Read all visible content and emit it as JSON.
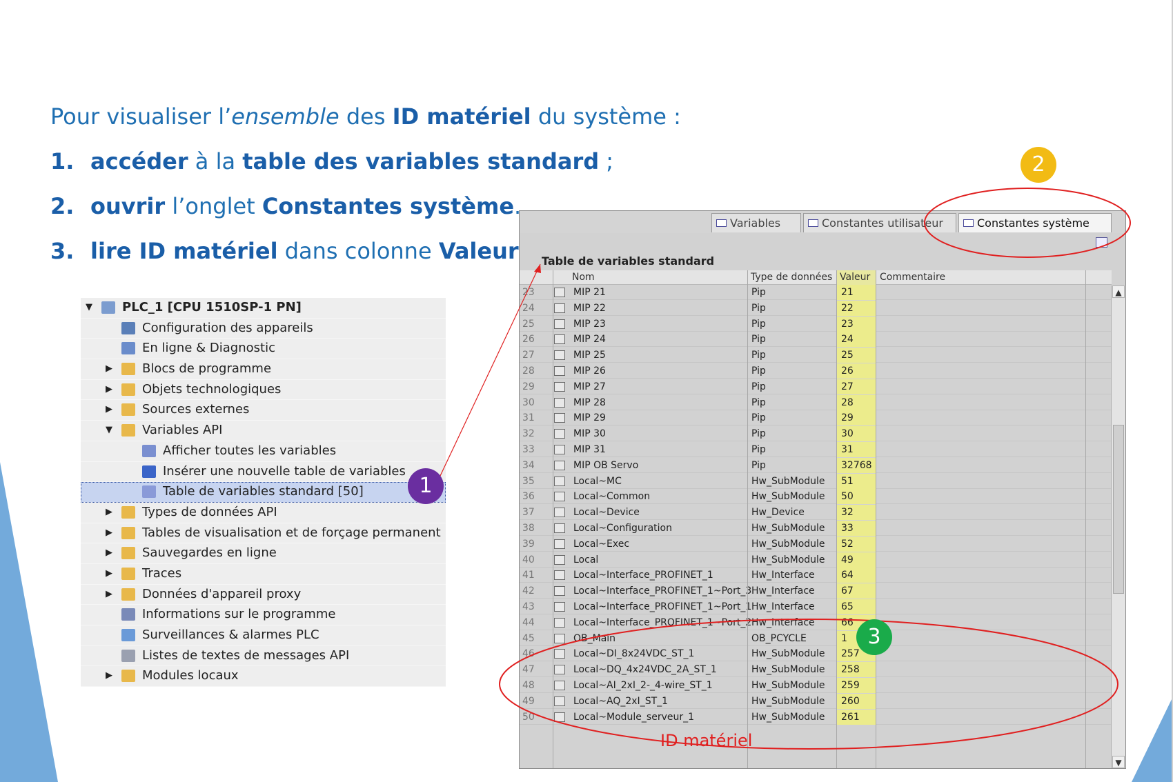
{
  "heading": {
    "prefix": "Pour visualiser l’",
    "italic": "ensemble",
    "mid": " des ",
    "bold": "ID matériel",
    "suffix": " du système :"
  },
  "steps": [
    {
      "num": "1.",
      "bold1": "accéder",
      "text1": " à la ",
      "bold2": "table des variables standard",
      "text2": " ;"
    },
    {
      "num": "2.",
      "bold1": "ouvrir",
      "text1": " l’onglet ",
      "bold2": "Constantes système",
      "text2": "."
    },
    {
      "num": "3.",
      "bold1": "lire ID matériel",
      "text1": " dans colonne ",
      "bold2": "Valeur",
      "text2": ""
    }
  ],
  "tree": {
    "root": "PLC_1 [CPU 1510SP-1 PN]",
    "items": [
      {
        "label": "Configuration des appareils",
        "level": 1,
        "arrow": "",
        "icon": "device-config-icon"
      },
      {
        "label": "En ligne & Diagnostic",
        "level": 1,
        "arrow": "",
        "icon": "diagnostic-icon"
      },
      {
        "label": "Blocs de programme",
        "level": 1,
        "arrow": "▶",
        "icon": "folder-icon"
      },
      {
        "label": "Objets technologiques",
        "level": 1,
        "arrow": "▶",
        "icon": "folder-icon"
      },
      {
        "label": "Sources externes",
        "level": 1,
        "arrow": "▶",
        "icon": "folder-icon"
      },
      {
        "label": "Variables API",
        "level": 1,
        "arrow": "▼",
        "icon": "folder-open-icon"
      },
      {
        "label": "Afficher toutes les variables",
        "level": 2,
        "arrow": "",
        "icon": "variables-icon"
      },
      {
        "label": "Insérer une nouvelle table de variables",
        "level": 2,
        "arrow": "",
        "icon": "new-table-icon"
      },
      {
        "label": "Table de variables standard [50]",
        "level": 2,
        "arrow": "",
        "icon": "variable-table-icon",
        "selected": true
      },
      {
        "label": "Types de données API",
        "level": 1,
        "arrow": "▶",
        "icon": "folder-icon"
      },
      {
        "label": "Tables de visualisation et de forçage permanent",
        "level": 1,
        "arrow": "▶",
        "icon": "folder-icon"
      },
      {
        "label": "Sauvegardes en ligne",
        "level": 1,
        "arrow": "▶",
        "icon": "folder-icon"
      },
      {
        "label": "Traces",
        "level": 1,
        "arrow": "▶",
        "icon": "folder-icon"
      },
      {
        "label": "Données d'appareil proxy",
        "level": 1,
        "arrow": "▶",
        "icon": "folder-icon"
      },
      {
        "label": "Informations sur le programme",
        "level": 1,
        "arrow": "",
        "icon": "program-info-icon"
      },
      {
        "label": "Surveillances & alarmes PLC",
        "level": 1,
        "arrow": "",
        "icon": "alarms-icon"
      },
      {
        "label": "Listes de textes de messages API",
        "level": 1,
        "arrow": "",
        "icon": "text-list-icon"
      },
      {
        "label": "Modules locaux",
        "level": 1,
        "arrow": "▶",
        "icon": "folder-icon"
      }
    ]
  },
  "tabs": [
    {
      "label": "Variables",
      "active": false
    },
    {
      "label": "Constantes utilisateur",
      "active": false
    },
    {
      "label": "Constantes système",
      "active": true
    }
  ],
  "table": {
    "title": "Table de variables standard",
    "columns": {
      "nom": "Nom",
      "type": "Type de données",
      "valeur": "Valeur",
      "commentaire": "Commentaire"
    },
    "rows": [
      {
        "num": "23",
        "nom": "MIP 21",
        "type": "Pip",
        "valeur": "21"
      },
      {
        "num": "24",
        "nom": "MIP 22",
        "type": "Pip",
        "valeur": "22"
      },
      {
        "num": "25",
        "nom": "MIP 23",
        "type": "Pip",
        "valeur": "23"
      },
      {
        "num": "26",
        "nom": "MIP 24",
        "type": "Pip",
        "valeur": "24"
      },
      {
        "num": "27",
        "nom": "MIP 25",
        "type": "Pip",
        "valeur": "25"
      },
      {
        "num": "28",
        "nom": "MIP 26",
        "type": "Pip",
        "valeur": "26"
      },
      {
        "num": "29",
        "nom": "MIP 27",
        "type": "Pip",
        "valeur": "27"
      },
      {
        "num": "30",
        "nom": "MIP 28",
        "type": "Pip",
        "valeur": "28"
      },
      {
        "num": "31",
        "nom": "MIP 29",
        "type": "Pip",
        "valeur": "29"
      },
      {
        "num": "32",
        "nom": "MIP 30",
        "type": "Pip",
        "valeur": "30"
      },
      {
        "num": "33",
        "nom": "MIP 31",
        "type": "Pip",
        "valeur": "31"
      },
      {
        "num": "34",
        "nom": "MIP OB Servo",
        "type": "Pip",
        "valeur": "32768"
      },
      {
        "num": "35",
        "nom": "Local~MC",
        "type": "Hw_SubModule",
        "valeur": "51"
      },
      {
        "num": "36",
        "nom": "Local~Common",
        "type": "Hw_SubModule",
        "valeur": "50"
      },
      {
        "num": "37",
        "nom": "Local~Device",
        "type": "Hw_Device",
        "valeur": "32"
      },
      {
        "num": "38",
        "nom": "Local~Configuration",
        "type": "Hw_SubModule",
        "valeur": "33"
      },
      {
        "num": "39",
        "nom": "Local~Exec",
        "type": "Hw_SubModule",
        "valeur": "52"
      },
      {
        "num": "40",
        "nom": "Local",
        "type": "Hw_SubModule",
        "valeur": "49"
      },
      {
        "num": "41",
        "nom": "Local~Interface_PROFINET_1",
        "type": "Hw_Interface",
        "valeur": "64"
      },
      {
        "num": "42",
        "nom": "Local~Interface_PROFINET_1~Port_3",
        "type": "Hw_Interface",
        "valeur": "67"
      },
      {
        "num": "43",
        "nom": "Local~Interface_PROFINET_1~Port_1",
        "type": "Hw_Interface",
        "valeur": "65"
      },
      {
        "num": "44",
        "nom": "Local~Interface_PROFINET_1~Port_2",
        "type": "Hw_Interface",
        "valeur": "66"
      },
      {
        "num": "45",
        "nom": "OB_Main",
        "type": "OB_PCYCLE",
        "valeur": "1"
      },
      {
        "num": "46",
        "nom": "Local~DI_8x24VDC_ST_1",
        "type": "Hw_SubModule",
        "valeur": "257"
      },
      {
        "num": "47",
        "nom": "Local~DQ_4x24VDC_2A_ST_1",
        "type": "Hw_SubModule",
        "valeur": "258"
      },
      {
        "num": "48",
        "nom": "Local~AI_2xI_2-_4-wire_ST_1",
        "type": "Hw_SubModule",
        "valeur": "259"
      },
      {
        "num": "49",
        "nom": "Local~AQ_2xI_ST_1",
        "type": "Hw_SubModule",
        "valeur": "260"
      },
      {
        "num": "50",
        "nom": "Local~Module_serveur_1",
        "type": "Hw_SubModule",
        "valeur": "261"
      }
    ]
  },
  "badges": [
    {
      "label": "1",
      "color": "#6a2ea0"
    },
    {
      "label": "2",
      "color": "#f2bb14"
    },
    {
      "label": "3",
      "color": "#1aab4a"
    }
  ],
  "annotation_label": "ID matériel",
  "colors": {
    "accent_blue": "#1a5ea8",
    "annotation_red": "#e02020",
    "value_highlight": "#ecec8c"
  }
}
